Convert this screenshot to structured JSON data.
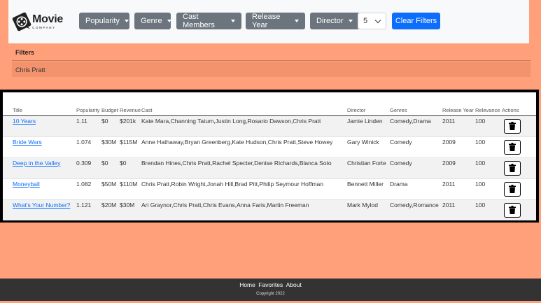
{
  "brand": {
    "name": "Movie",
    "sub": "COMPANY"
  },
  "filters_bar": {
    "dropdowns": [
      "Popularity",
      "Genre",
      "Cast Members",
      "Release Year",
      "Director"
    ],
    "page_size": "5",
    "clear_label": "Clear Filters"
  },
  "filters": {
    "heading": "Filters",
    "active": "Chris Pratt"
  },
  "table": {
    "headers": [
      "Title",
      "Popularity",
      "Budget",
      "Revenue",
      "Cast",
      "Director",
      "Genres",
      "Release Year",
      "Relevance",
      "Actions"
    ],
    "rows": [
      {
        "title": "10 Years",
        "popularity": "1.11",
        "budget": "$0",
        "revenue": "$201k",
        "cast": "Kate Mara,Channing Tatum,Justin Long,Rosario Dawson,Chris Pratt",
        "director": "Jamie Linden",
        "genres": "Comedy,Drama",
        "year": "2011",
        "relevance": "100"
      },
      {
        "title": "Bride Wars",
        "popularity": "1.074",
        "budget": "$30M",
        "revenue": "$115M",
        "cast": "Anne Hathaway,Bryan Greenberg,Kate Hudson,Chris Pratt,Steve Howey",
        "director": "Gary Winick",
        "genres": "Comedy",
        "year": "2009",
        "relevance": "100"
      },
      {
        "title": "Deep in the Valley",
        "popularity": "0.309",
        "budget": "$0",
        "revenue": "$0",
        "cast": "Brendan Hines,Chris Pratt,Rachel Specter,Denise Richards,Blanca Soto",
        "director": "Christian Forte",
        "genres": "Comedy",
        "year": "2009",
        "relevance": "100"
      },
      {
        "title": "Moneyball",
        "popularity": "1.082",
        "budget": "$50M",
        "revenue": "$110M",
        "cast": "Chris Pratt,Robin Wright,Jonah Hill,Brad Pitt,Philip Seymour Hoffman",
        "director": "Bennett Miller",
        "genres": "Drama",
        "year": "2011",
        "relevance": "100"
      },
      {
        "title": "What's Your Number?",
        "popularity": "1.121",
        "budget": "$20M",
        "revenue": "$30M",
        "cast": "Ari Graynor,Chris Pratt,Chris Evans,Anna Faris,Martin Freeman",
        "director": "Mark Mylod",
        "genres": "Comedy,Romance",
        "year": "2011",
        "relevance": "100"
      }
    ],
    "action_icon": "trash-icon"
  },
  "footer": {
    "links": [
      "Home",
      "Favorites",
      "About"
    ],
    "copyright": "Copyright 2022"
  },
  "colors": {
    "page_bg": "#ffa07a",
    "primary": "#0d6efd",
    "secondary": "#6c757d",
    "footer_bg": "#333333"
  }
}
